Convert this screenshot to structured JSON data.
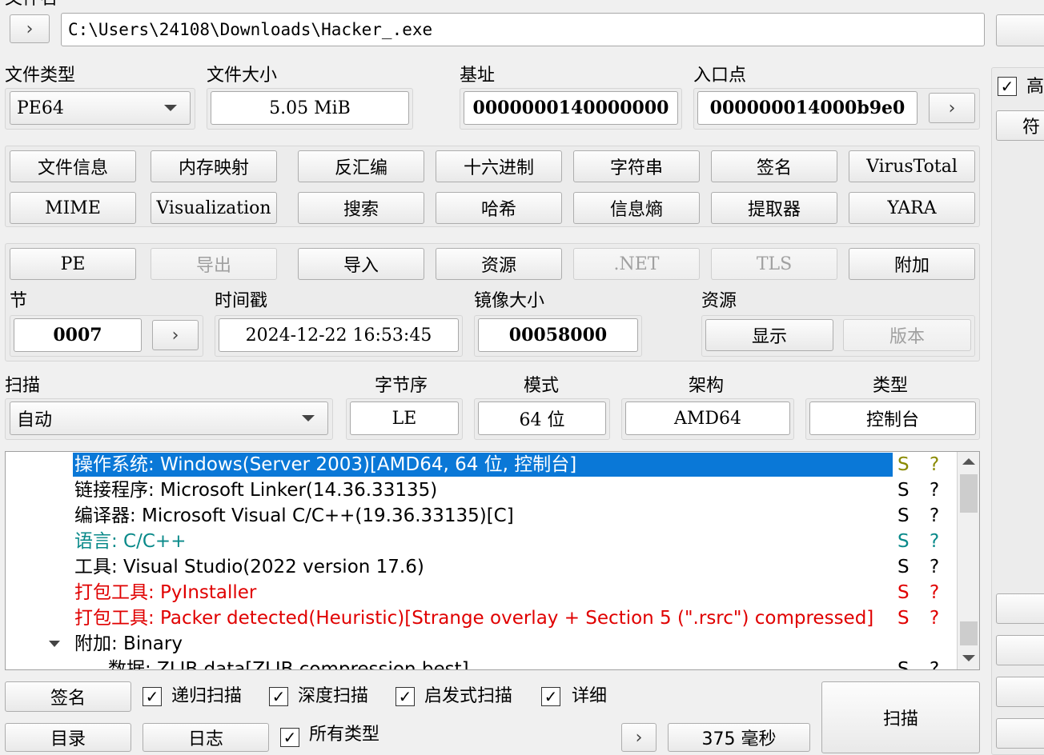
{
  "file": {
    "path": "C:\\Users\\24108\\Downloads\\Hacker_.exe",
    "top_label_partial": "文件名"
  },
  "info": {
    "file_type_label": "文件类型",
    "file_type_value": "PE64",
    "file_size_label": "文件大小",
    "file_size_value": "5.05 MiB",
    "base_label": "基址",
    "base_value": "0000000140000000",
    "entry_label": "入口点",
    "entry_value": "000000014000b9e0"
  },
  "toolbar": {
    "row1": [
      "文件信息",
      "内存映射",
      "反汇编",
      "十六进制",
      "字符串",
      "签名",
      "VirusTotal"
    ],
    "row2": [
      "MIME",
      "Visualization",
      "搜索",
      "哈希",
      "信息熵",
      "提取器",
      "YARA"
    ]
  },
  "pe": {
    "buttons": [
      "PE",
      "导出",
      "导入",
      "资源",
      ".NET",
      "TLS",
      "附加"
    ],
    "disabled": [
      false,
      true,
      false,
      false,
      true,
      true,
      false
    ],
    "section_label": "节",
    "section_value": "0007",
    "timestamp_label": "时间戳",
    "timestamp_value": "2024-12-22 16:53:45",
    "image_size_label": "镜像大小",
    "image_size_value": "00058000",
    "resources_label": "资源",
    "show_button": "显示",
    "version_button": "版本"
  },
  "scan": {
    "scan_label": "扫描",
    "scan_value": "自动",
    "endian_label": "字节序",
    "endian_value": "LE",
    "mode_label": "模式",
    "mode_value": "64 位",
    "arch_label": "架构",
    "arch_value": "AMD64",
    "type_label": "类型",
    "type_value": "控制台"
  },
  "results": [
    {
      "text": "操作系统: Windows(Server 2003)[AMD64, 64 位, 控制台]",
      "s": "S",
      "q": "?",
      "style": "sel"
    },
    {
      "text": "链接程序: Microsoft Linker(14.36.33135)",
      "s": "S",
      "q": "?",
      "style": "normal"
    },
    {
      "text": "编译器: Microsoft Visual C/C++(19.36.33135)[C]",
      "s": "S",
      "q": "?",
      "style": "normal"
    },
    {
      "text": "语言: C/C++",
      "s": "S",
      "q": "?",
      "style": "teal"
    },
    {
      "text": "工具: Visual Studio(2022 version 17.6)",
      "s": "S",
      "q": "?",
      "style": "normal"
    },
    {
      "text": "打包工具: PyInstaller",
      "s": "S",
      "q": "?",
      "style": "red"
    },
    {
      "text": "打包工具: Packer detected(Heuristic)[Strange overlay + Section 5 (\".rsrc\") compressed]",
      "s": "S",
      "q": "?",
      "style": "red"
    },
    {
      "text": "附加: Binary",
      "s": "",
      "q": "",
      "style": "normal"
    },
    {
      "text": "数据: ZLIB data[ZLIB compression best]",
      "s": "S",
      "q": "?",
      "style": "normal"
    }
  ],
  "bottom": {
    "signature_button": "签名",
    "recursive_label": "递归扫描",
    "deep_label": "深度扫描",
    "heuristic_label": "启发式扫描",
    "verbose_label": "详细",
    "dir_button": "目录",
    "log_button": "日志",
    "all_types_label": "所有类型",
    "time_value": "375 毫秒",
    "scan_button": "扫描"
  },
  "right_panel": {
    "advanced_label": "高",
    "symbols_button": "符"
  }
}
